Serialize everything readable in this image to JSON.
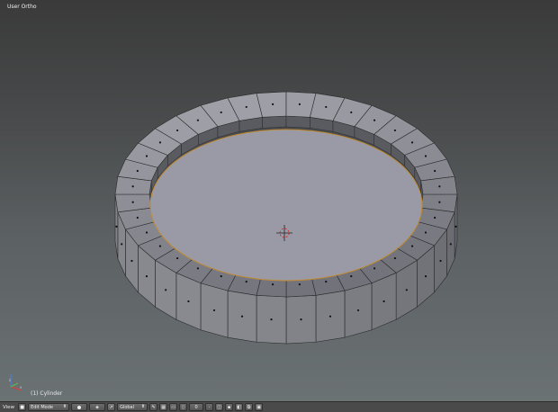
{
  "viewport": {
    "title": "User Ortho",
    "object_label": "(1) Cylinder",
    "axis_labels": {
      "x": "x",
      "y": "y",
      "z": "z"
    }
  },
  "header": {
    "view_menu": "View",
    "mode_select": "Edit Mode",
    "orientation_select": "Global",
    "layer_value": "0",
    "icons": [
      "editor-type-icon",
      "mode-cube-icon",
      "viewport-shading-icon",
      "pivot-point-icon",
      "manipulator-icon",
      "translate-icon",
      "rotate-icon",
      "scale-icon",
      "transform-orientation-icon",
      "layer-icon",
      "proportional-edit-icon",
      "vertex-select-icon",
      "edge-select-icon",
      "face-select-icon",
      "occlude-icon",
      "snap-icon",
      "render-icon"
    ]
  },
  "mesh": {
    "name": "Cylinder",
    "segments": 36,
    "colors": {
      "wall": "#7d7f86",
      "wall_dark": "#5a5b61",
      "top_face": "#92929c",
      "inner_face": "#9a9aa6",
      "edge": "#2a2a2a",
      "rim_highlight": "#c08a32",
      "vertex_dot": "#111111"
    }
  },
  "colors": {
    "accent": "#c08a32",
    "cursor_red": "#d92b2b",
    "header_bg": "#4a4a4a"
  }
}
